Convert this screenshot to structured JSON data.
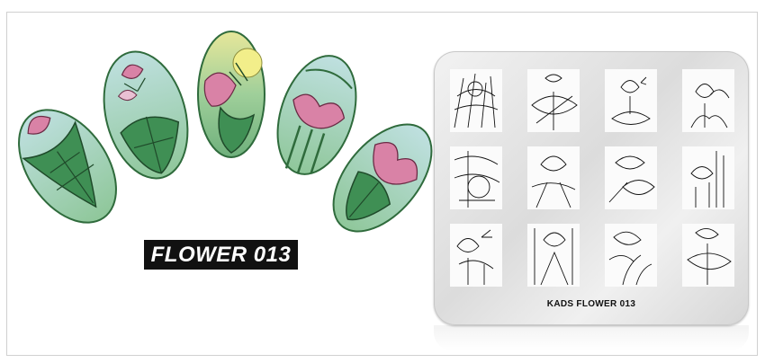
{
  "product_label": "FLOWER 013",
  "plate": {
    "caption": "KADS FLOWER 013",
    "design_count": 12
  },
  "nails": [
    {
      "motif": "lotus-leaf"
    },
    {
      "motif": "lotus-butterfly"
    },
    {
      "motif": "lotus-sun"
    },
    {
      "motif": "lotus-bloom"
    },
    {
      "motif": "lotus-reeds"
    }
  ],
  "colors": {
    "leaf_green": "#3f8f54",
    "petal_pink": "#d982a6",
    "sky_blue": "#a9d4d8",
    "label_bg": "#111111"
  }
}
